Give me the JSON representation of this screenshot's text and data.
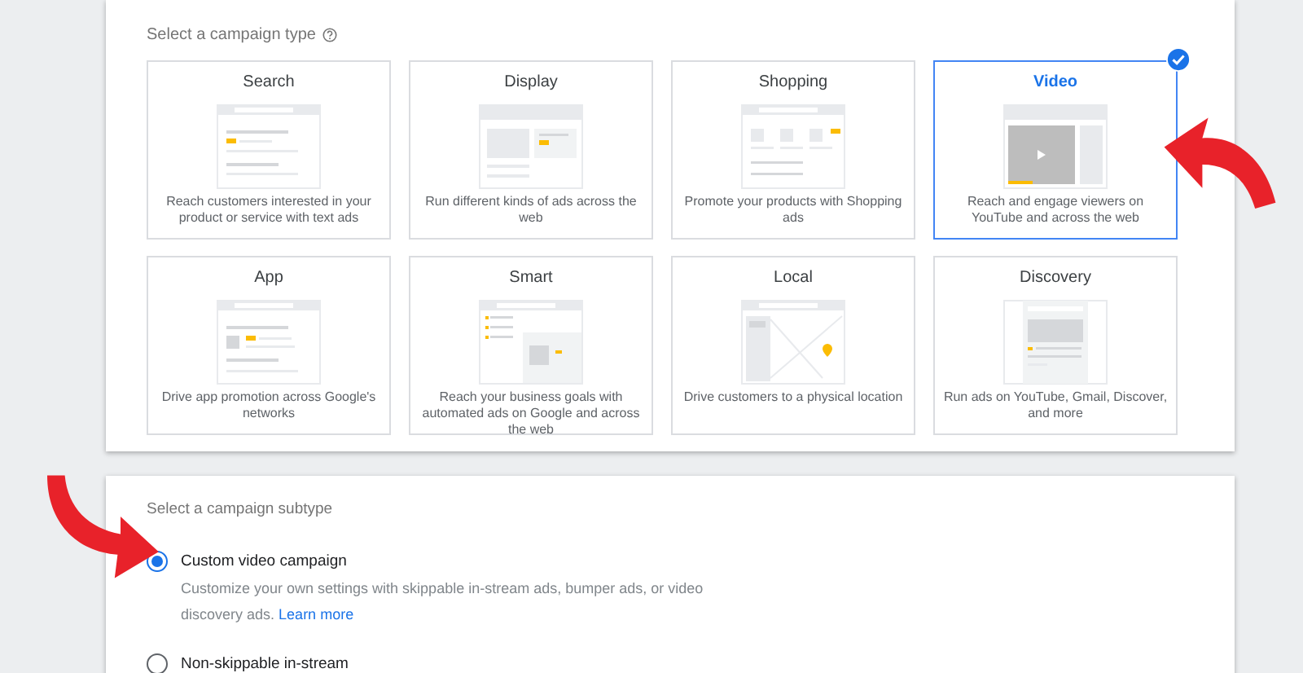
{
  "type_section": {
    "heading": "Select a campaign type",
    "types": [
      {
        "kind": "search",
        "title": "Search",
        "description": "Reach customers interested in your product or service with text ads",
        "selected": false
      },
      {
        "kind": "display",
        "title": "Display",
        "description": "Run different kinds of ads across the web",
        "selected": false
      },
      {
        "kind": "shopping",
        "title": "Shopping",
        "description": "Promote your products with Shopping ads",
        "selected": false
      },
      {
        "kind": "video",
        "title": "Video",
        "description": "Reach and engage viewers on YouTube and across the web",
        "selected": true
      },
      {
        "kind": "app",
        "title": "App",
        "description": "Drive app promotion across Google's networks",
        "selected": false
      },
      {
        "kind": "smart",
        "title": "Smart",
        "description": "Reach your business goals with automated ads on Google and across the web",
        "selected": false
      },
      {
        "kind": "local",
        "title": "Local",
        "description": "Drive customers to a physical location",
        "selected": false
      },
      {
        "kind": "discovery",
        "title": "Discovery",
        "description": "Run ads on YouTube, Gmail, Discover, and more",
        "selected": false
      }
    ]
  },
  "subtype_section": {
    "heading": "Select a campaign subtype",
    "options": [
      {
        "label": "Custom video campaign",
        "selected": true,
        "description": "Customize your own settings with skippable in-stream ads, bumper ads, or video discovery ads.",
        "link": "Learn more"
      },
      {
        "label": "Non-skippable in-stream",
        "selected": false
      }
    ]
  }
}
